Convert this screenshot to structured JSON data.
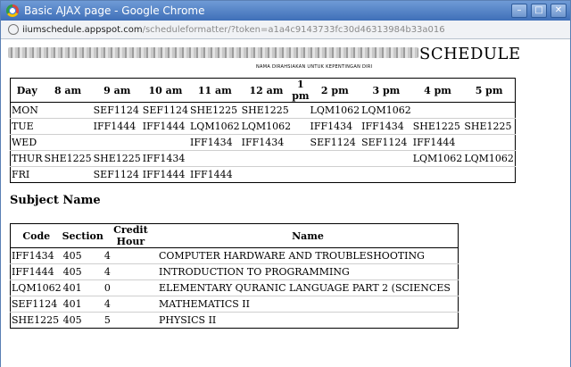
{
  "window": {
    "title": "Basic AJAX page - Google Chrome",
    "minimize": "–",
    "maximize": "□",
    "close": "✕"
  },
  "address": {
    "host": "iiumschedule.appspot.com",
    "path": "/scheduleformatter/?token=a1a4c9143733fc30d46313984b33a016"
  },
  "page": {
    "heading": "SCHEDULE",
    "subnote": "NAMA DIRAHSIAKAN UNTUK KEPENTINGAN DIRI",
    "subject_heading": "Subject Name"
  },
  "schedule": {
    "headers": [
      "Day",
      "8 am",
      "9 am",
      "10 am",
      "11 am",
      "12 am",
      "1 pm",
      "2 pm",
      "3 pm",
      "4 pm",
      "5 pm"
    ],
    "rows": [
      [
        "MON",
        "",
        "SEF1124",
        "SEF1124",
        "SHE1225",
        "SHE1225",
        "",
        "LQM1062",
        "LQM1062",
        "",
        ""
      ],
      [
        "TUE",
        "",
        "IFF1444",
        "IFF1444",
        "LQM1062",
        "LQM1062",
        "",
        "IFF1434",
        "IFF1434",
        "SHE1225",
        "SHE1225"
      ],
      [
        "WED",
        "",
        "",
        "",
        "IFF1434",
        "IFF1434",
        "",
        "SEF1124",
        "SEF1124",
        "IFF1444",
        ""
      ],
      [
        "THUR",
        "SHE1225",
        "SHE1225",
        "IFF1434",
        "",
        "",
        "",
        "",
        "",
        "LQM1062",
        "LQM1062"
      ],
      [
        "FRI",
        "",
        "SEF1124",
        "IFF1444",
        "IFF1444",
        "",
        "",
        "",
        "",
        "",
        ""
      ]
    ]
  },
  "subjects": {
    "headers": [
      "Code",
      "Section",
      "Credit Hour",
      "Name"
    ],
    "rows": [
      [
        "IFF1434",
        "405",
        "4",
        "COMPUTER HARDWARE AND TROUBLESHOOTING"
      ],
      [
        "IFF1444",
        "405",
        "4",
        "INTRODUCTION TO PROGRAMMING"
      ],
      [
        "LQM1062",
        "401",
        "0",
        "ELEMENTARY  QURANIC LANGUAGE PART 2 (SCIENCES"
      ],
      [
        "SEF1124",
        "401",
        "4",
        "MATHEMATICS II"
      ],
      [
        "SHE1225",
        "405",
        "5",
        "PHYSICS II"
      ]
    ]
  }
}
